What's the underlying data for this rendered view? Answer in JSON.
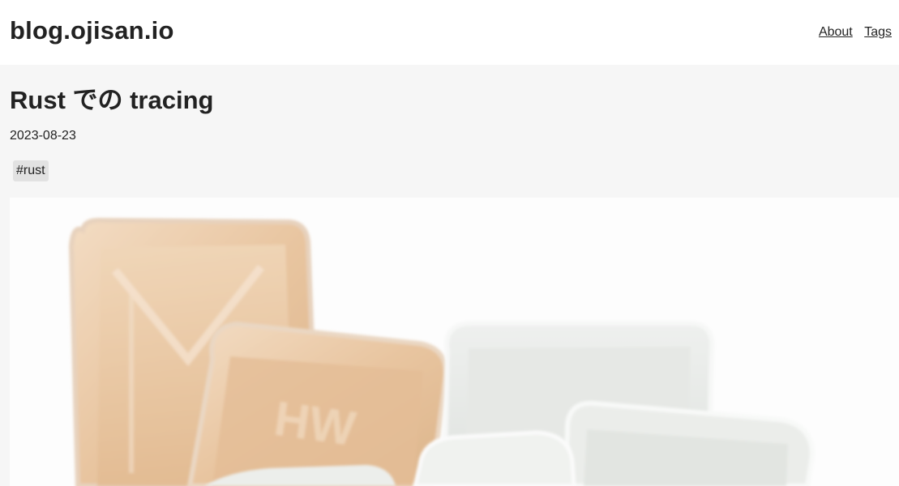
{
  "site": {
    "title": "blog.ojisan.io",
    "nav": [
      {
        "label": "About"
      },
      {
        "label": "Tags"
      }
    ]
  },
  "post": {
    "title": "Rust での tracing",
    "date": "2023-08-23",
    "tags": [
      "#rust"
    ],
    "hero_image": {
      "subject": "photo-of-foam-food-trays",
      "colors": {
        "tan_tray": "#e9c9a6",
        "white_tray": "#e7e9e6",
        "background": "#fdfdfd"
      }
    }
  }
}
